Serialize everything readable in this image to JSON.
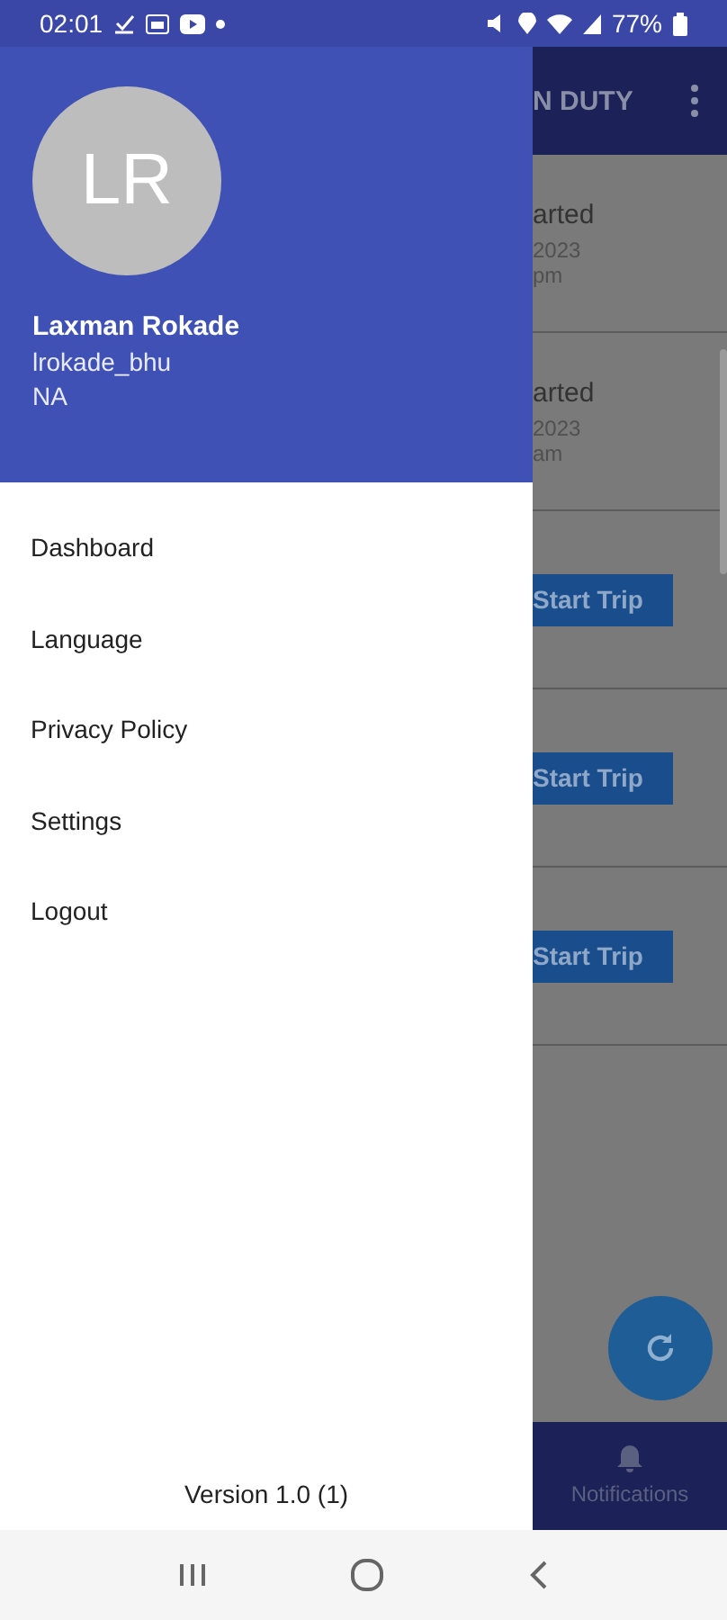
{
  "status_bar": {
    "time": "02:01",
    "battery": "77%"
  },
  "drawer": {
    "avatar_initials": "LR",
    "name": "Laxman Rokade",
    "username": "lrokade_bhu",
    "role": "NA",
    "items": [
      {
        "label": "Dashboard"
      },
      {
        "label": "Language"
      },
      {
        "label": "Privacy Policy"
      },
      {
        "label": "Settings"
      },
      {
        "label": "Logout"
      }
    ],
    "version": "Version 1.0 (1)"
  },
  "background": {
    "title": "N DUTY",
    "cards": [
      {
        "kind": "status",
        "status": "arted",
        "date": "2023",
        "time": "pm"
      },
      {
        "kind": "status",
        "status": "arted",
        "date": "2023",
        "time": "am"
      },
      {
        "kind": "action",
        "button": "Start Trip"
      },
      {
        "kind": "action",
        "button": "Start Trip"
      },
      {
        "kind": "action",
        "button": "Start Trip"
      }
    ],
    "bottom_nav": {
      "label": "Notifications"
    }
  }
}
